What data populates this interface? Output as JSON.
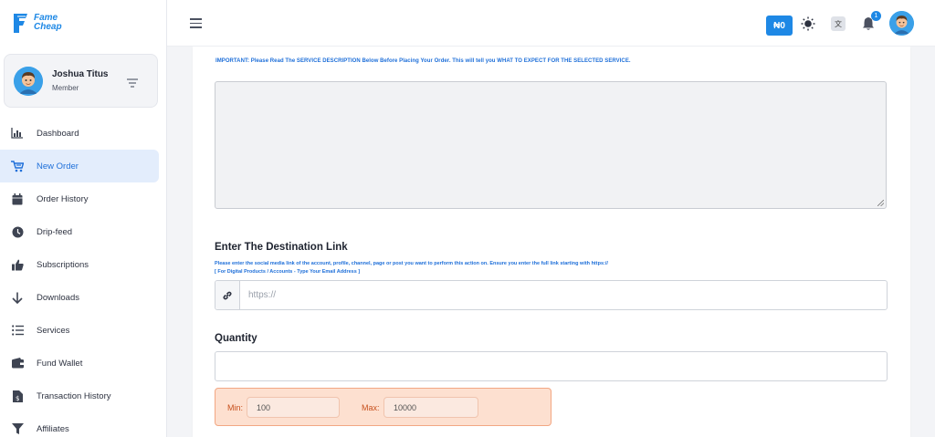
{
  "brand": {
    "line1": "Fame",
    "line2": "Cheap",
    "color": "#1e88e5"
  },
  "user": {
    "name": "Joshua Titus",
    "role": "Member"
  },
  "sidebar": {
    "items": [
      {
        "label": "Dashboard",
        "icon": "bar-chart-icon",
        "active": false
      },
      {
        "label": "New Order",
        "icon": "cart-icon",
        "active": true
      },
      {
        "label": "Order History",
        "icon": "calendar-icon",
        "active": false
      },
      {
        "label": "Drip-feed",
        "icon": "clock-icon",
        "active": false
      },
      {
        "label": "Subscriptions",
        "icon": "thumbs-up-icon",
        "active": false
      },
      {
        "label": "Downloads",
        "icon": "arrow-down-icon",
        "active": false
      },
      {
        "label": "Services",
        "icon": "list-icon",
        "active": false
      },
      {
        "label": "Fund Wallet",
        "icon": "wallet-icon",
        "active": false
      },
      {
        "label": "Transaction History",
        "icon": "receipt-icon",
        "active": false
      },
      {
        "label": "Affiliates",
        "icon": "funnel-icon",
        "active": false
      }
    ]
  },
  "header": {
    "wallet_balance": "₦0",
    "notifications_count": "1",
    "translate_glyph": "文"
  },
  "form": {
    "important_notice": "IMPORTANT: Please Read The SERVICE DESCRIPTION Below Before Placing Your Order. This will tell you WHAT TO EXPECT FOR THE SELECTED SERVICE.",
    "link_title": "Enter The Destination Link",
    "link_help_1": "Please enter the social media link of the account, profile, channel, page or post you want to perform this action on. Ensure you enter the full link starting with https://",
    "link_help_2": "[ For Digital Products / Accounts - Type Your Email Address ]",
    "link_placeholder": "https://",
    "quantity_title": "Quantity",
    "min_label": "Min:",
    "min_value": "100",
    "max_label": "Max:",
    "max_value": "10000"
  },
  "colors": {
    "accent": "#1e88e5",
    "active_bg": "#e3edfc",
    "minmax_bg": "#fde0d0",
    "minmax_text": "#c8501d"
  }
}
